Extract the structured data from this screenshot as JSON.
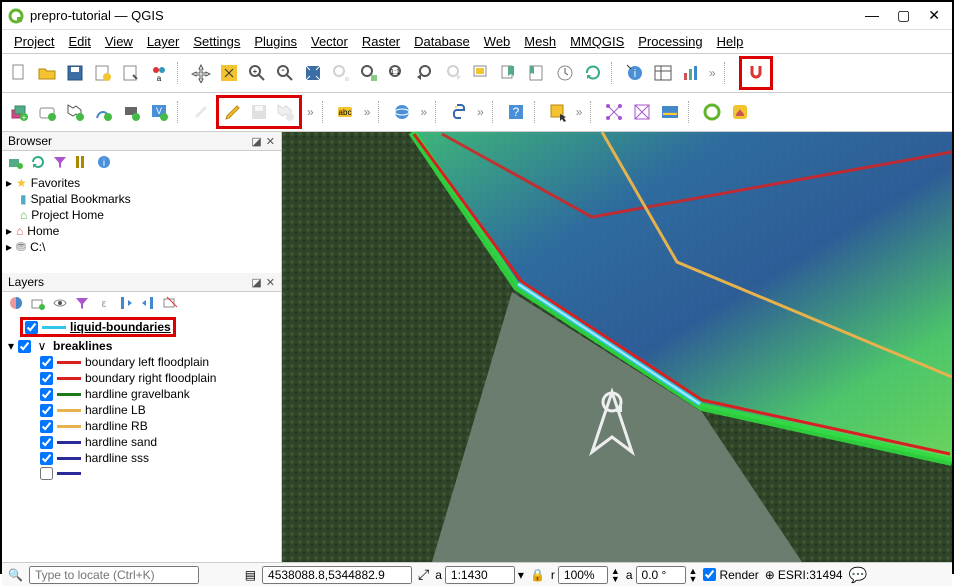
{
  "window": {
    "title": "prepro-tutorial — QGIS"
  },
  "menubar": [
    "Project",
    "Edit",
    "View",
    "Layer",
    "Settings",
    "Plugins",
    "Vector",
    "Raster",
    "Database",
    "Web",
    "Mesh",
    "MMQGIS",
    "Processing",
    "Help"
  ],
  "browser": {
    "title": "Browser",
    "items": [
      {
        "icon": "star",
        "label": "Favorites"
      },
      {
        "icon": "bookmark",
        "label": "Spatial Bookmarks"
      },
      {
        "icon": "home-green",
        "label": "Project Home"
      },
      {
        "icon": "home-red",
        "label": "Home"
      },
      {
        "icon": "drive",
        "label": "C:\\"
      }
    ]
  },
  "layers": {
    "title": "Layers",
    "highlighted": {
      "label": "liquid-boundaries",
      "color": "#2fc8e8"
    },
    "group": {
      "label": "breaklines"
    },
    "items": [
      {
        "label": "boundary left floodplain",
        "color": "#d72121"
      },
      {
        "label": "boundary right floodplain",
        "color": "#d72121"
      },
      {
        "label": "hardline gravelbank",
        "color": "#1c7a1c"
      },
      {
        "label": "hardline LB",
        "color": "#e6b24d"
      },
      {
        "label": "hardline RB",
        "color": "#e6b24d"
      },
      {
        "label": "hardline sand",
        "color": "#2a2a99"
      },
      {
        "label": "hardline sss",
        "color": "#2a2a99"
      }
    ]
  },
  "status": {
    "locator_placeholder": "Type to locate (Ctrl+K)",
    "coordinate": "4538088.8,5344882.9",
    "scale": "1:1430",
    "magnifier": "100%",
    "rotation": "0.0 °",
    "render": "Render",
    "crs": "ESRI:31494"
  },
  "toolbar_highlights": [
    "toggle-editing",
    "save-edits",
    "new-shapefile"
  ],
  "right_highlight": "snapping-magnet",
  "colors": {
    "highlight": "#d00",
    "accent_green": "#63b52f"
  }
}
